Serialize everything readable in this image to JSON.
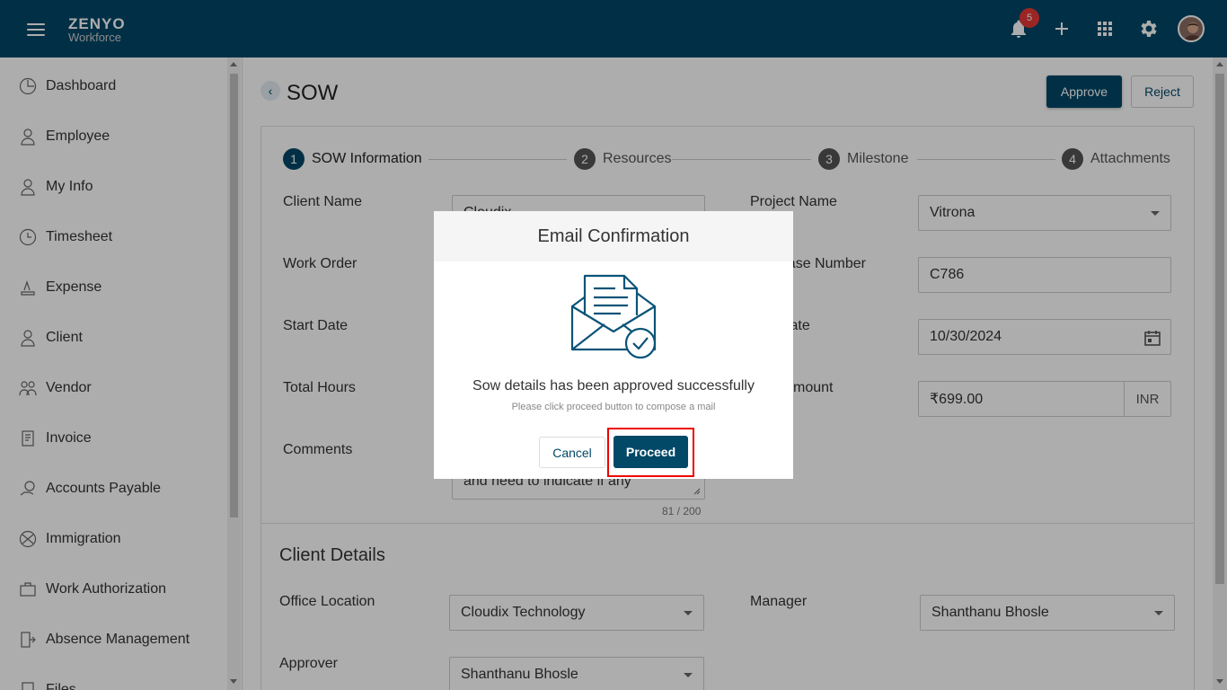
{
  "app": {
    "logo_top": "ZENYO",
    "logo_bottom": "Workforce",
    "notification_count": "5"
  },
  "sidebar": {
    "items": [
      {
        "label": "Dashboard",
        "icon": "dashboard-icon"
      },
      {
        "label": "Employee",
        "icon": "employee-icon"
      },
      {
        "label": "My Info",
        "icon": "my-info-icon"
      },
      {
        "label": "Timesheet",
        "icon": "clock-icon"
      },
      {
        "label": "Expense",
        "icon": "expense-icon"
      },
      {
        "label": "Client",
        "icon": "client-icon"
      },
      {
        "label": "Vendor",
        "icon": "vendor-icon"
      },
      {
        "label": "Invoice",
        "icon": "invoice-icon"
      },
      {
        "label": "Accounts Payable",
        "icon": "accounts-payable-icon"
      },
      {
        "label": "Immigration",
        "icon": "globe-icon"
      },
      {
        "label": "Work Authorization",
        "icon": "briefcase-icon"
      },
      {
        "label": "Absence Management",
        "icon": "exit-door-icon"
      },
      {
        "label": "Files",
        "icon": "files-icon"
      }
    ]
  },
  "page": {
    "title": "SOW",
    "approve_label": "Approve",
    "reject_label": "Reject"
  },
  "steps": [
    {
      "num": "1",
      "label": "SOW Information"
    },
    {
      "num": "2",
      "label": "Resources"
    },
    {
      "num": "3",
      "label": "Milestone"
    },
    {
      "num": "4",
      "label": "Attachments"
    }
  ],
  "form": {
    "client_name_label": "Client Name",
    "client_name_value": "Cloudix",
    "project_name_label": "Project Name",
    "project_name_value": "Vitrona",
    "work_order_label": "Work Order",
    "purchase_number_label": "Purchase Number",
    "purchase_number_value": "C786",
    "start_date_label": "Start Date",
    "end_date_label": "End Date",
    "end_date_value": "10/30/2024",
    "total_hours_label": "Total Hours",
    "total_amount_label": "Total Amount",
    "total_amount_value": "₹699.00",
    "currency": "INR",
    "comments_label": "Comments",
    "comments_value_visible": "and need to indicate if any",
    "comments_counter": "81 / 200"
  },
  "client_details": {
    "title": "Client Details",
    "office_location_label": "Office Location",
    "office_location_value": "Cloudix Technology",
    "manager_label": "Manager",
    "manager_value": "Shanthanu Bhosle",
    "approver_label": "Approver",
    "approver_value": "Shanthanu Bhosle"
  },
  "modal": {
    "title": "Email Confirmation",
    "message": "Sow details has been approved successfully",
    "sub_message": "Please click proceed button to compose a mail",
    "cancel_label": "Cancel",
    "proceed_label": "Proceed"
  },
  "colors": {
    "brand": "#024867",
    "accent": "#f5a623",
    "badge": "#e53935",
    "highlight": "#ee0000"
  }
}
